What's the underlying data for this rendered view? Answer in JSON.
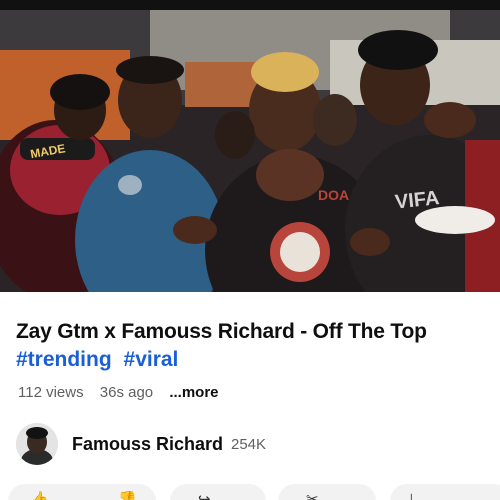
{
  "video": {
    "title": "Zay Gtm x Famouss Richard - Off The Top",
    "hashtags": [
      "#trending",
      "#viral"
    ],
    "views": "112 views",
    "age": "36s ago",
    "more_label": "...more",
    "progress": 0.3
  },
  "channel": {
    "name": "Famouss Richard",
    "subscribers": "254K"
  },
  "thumbnail_text": {
    "cap_left": "MADE",
    "shirt_right": "VIFA",
    "shirt_center": "DOA"
  },
  "colors": {
    "progress": "#ff0000",
    "hashtag": "#1a5fd6",
    "meta": "#606060"
  },
  "action_icons": [
    "like-icon",
    "share-icon",
    "download-icon",
    "clip-icon",
    "save-icon"
  ]
}
